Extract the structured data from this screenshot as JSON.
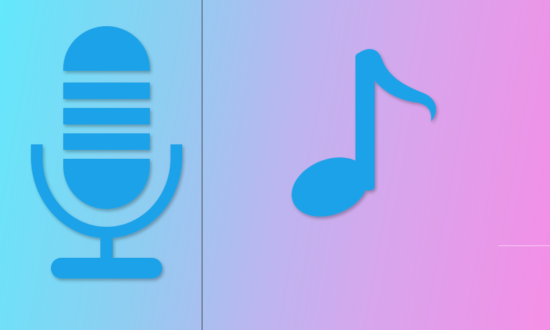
{
  "screen": {
    "background_colors": [
      "#63e8fb",
      "#b9b7f0",
      "#f58ee6"
    ],
    "divider_color": "#5a6474",
    "icon_color": "#1aa2e8"
  },
  "left_panel": {
    "icon": "microphone-icon"
  },
  "right_panel": {
    "icon": "music-note-icon"
  }
}
